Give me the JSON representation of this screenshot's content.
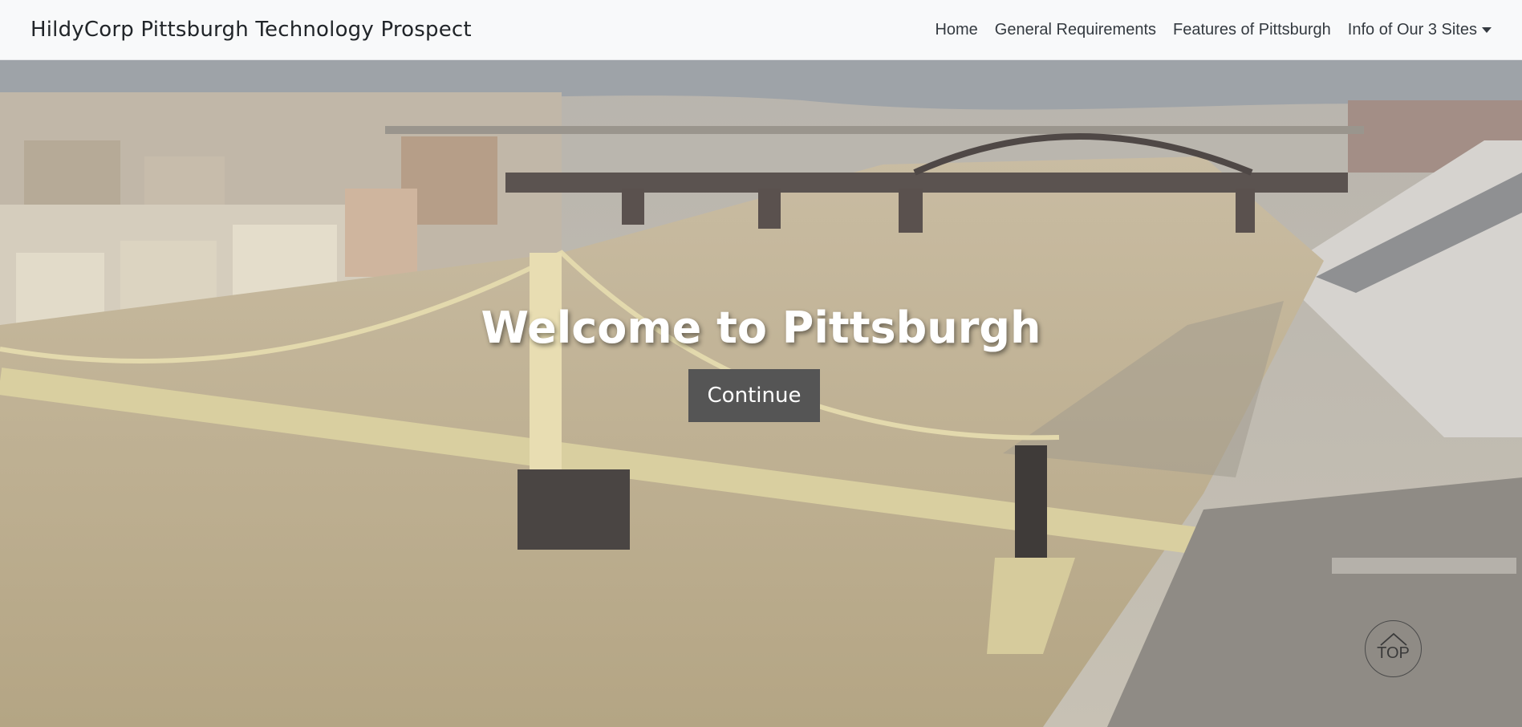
{
  "navbar": {
    "brand": "HildyCorp Pittsburgh Technology Prospect",
    "links": [
      {
        "label": "Home"
      },
      {
        "label": "General Requirements"
      },
      {
        "label": "Features of Pittsburgh"
      },
      {
        "label": "Info of Our 3 Sites",
        "dropdown": true
      }
    ]
  },
  "hero": {
    "heading": "Welcome to Pittsburgh",
    "button_label": "Continue",
    "image": "pittsburgh-bridges-river-aerial"
  },
  "back_to_top": {
    "label": "TOP",
    "icon": "chevron-up-icon"
  }
}
